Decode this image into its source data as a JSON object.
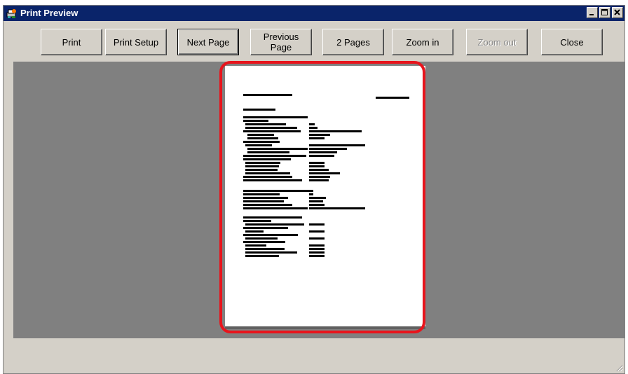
{
  "window": {
    "title": "Print Preview",
    "controls": [
      "minimize-icon",
      "maximize-icon",
      "close-icon"
    ]
  },
  "toolbar": {
    "print_label": "Print",
    "print_setup_label": "Print Setup",
    "next_page_label": "Next Page",
    "previous_page_line1": "Previous",
    "previous_page_line2": "Page",
    "two_pages_label": "2 Pages",
    "zoom_in_label": "Zoom in",
    "zoom_out_label": "Zoom out",
    "close_label": "Close"
  },
  "colors": {
    "title_bar": "#0a246a",
    "preview_background": "#808080",
    "highlight": "#e8141c"
  }
}
